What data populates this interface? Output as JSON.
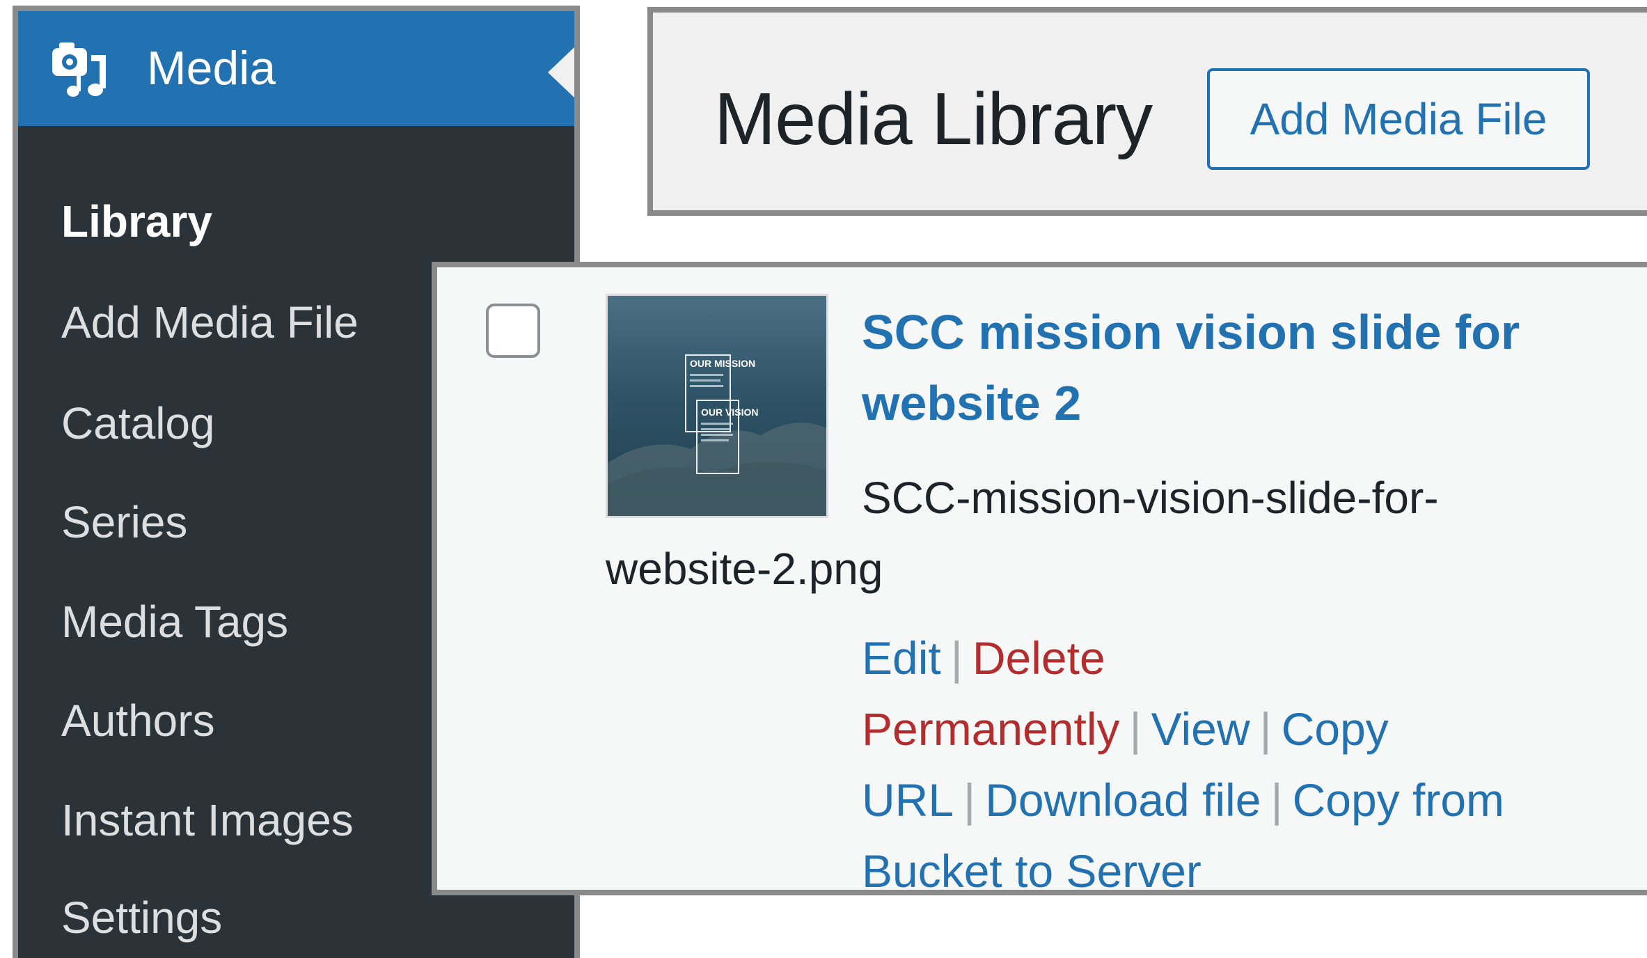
{
  "sidebar": {
    "title": "Media",
    "items": [
      {
        "label": "Library",
        "current": true
      },
      {
        "label": "Add Media File"
      },
      {
        "label": "Catalog"
      },
      {
        "label": "Series"
      },
      {
        "label": "Media Tags"
      },
      {
        "label": "Authors"
      },
      {
        "label": "Instant Images"
      },
      {
        "label": "Settings"
      }
    ]
  },
  "header": {
    "title": "Media Library",
    "add_button_label": "Add Media File"
  },
  "media_item": {
    "title": "SCC mission vision slide for website 2",
    "filename": "SCC-mission-vision-slide-for-website-2.png",
    "thumbnail": {
      "heading_1": "OUR MISSION",
      "heading_2": "OUR VISION"
    },
    "actions": {
      "edit": "Edit",
      "delete": "Delete Permanently",
      "view": "View",
      "copy_url": "Copy URL",
      "download": "Download file",
      "copy_bucket": "Copy from Bucket to Server",
      "separator": "|"
    }
  },
  "colors": {
    "sidebar_bg": "#2c3338",
    "accent": "#2271b1",
    "delete": "#b32d2e",
    "panel_bg": "#f0f0f1"
  }
}
